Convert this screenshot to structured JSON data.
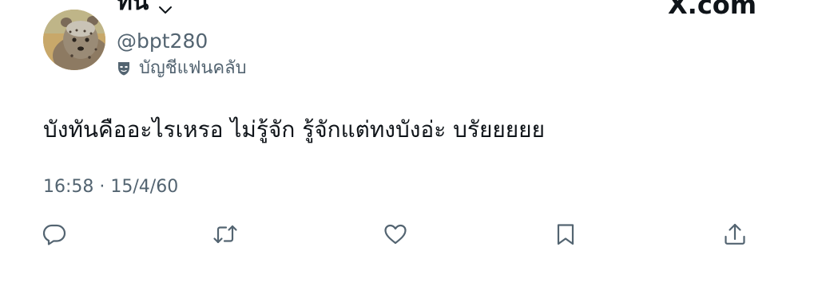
{
  "author": {
    "display_name": "ทน",
    "handle": "@bpt280",
    "badge_icon": "fan-club-mask-icon",
    "badge_label": "บัญชีแฟนคลับ",
    "menu_icon": "chevron-down-icon"
  },
  "site": {
    "logo_text": "X.com"
  },
  "tweet": {
    "text": "บังทันคืออะไรเหรอ ไม่รู้จัก รู้จักแต่ทงบังอ่ะ บรัยยยยย",
    "timestamp": "16:58 · 15/4/60"
  },
  "actions": [
    {
      "name": "reply",
      "icon": "reply-icon"
    },
    {
      "name": "retweet",
      "icon": "retweet-icon"
    },
    {
      "name": "like",
      "icon": "heart-icon"
    },
    {
      "name": "bookmark",
      "icon": "bookmark-icon"
    },
    {
      "name": "share",
      "icon": "share-icon"
    }
  ],
  "colors": {
    "text_primary": "#0f1419",
    "text_secondary": "#536471",
    "background": "#ffffff"
  }
}
